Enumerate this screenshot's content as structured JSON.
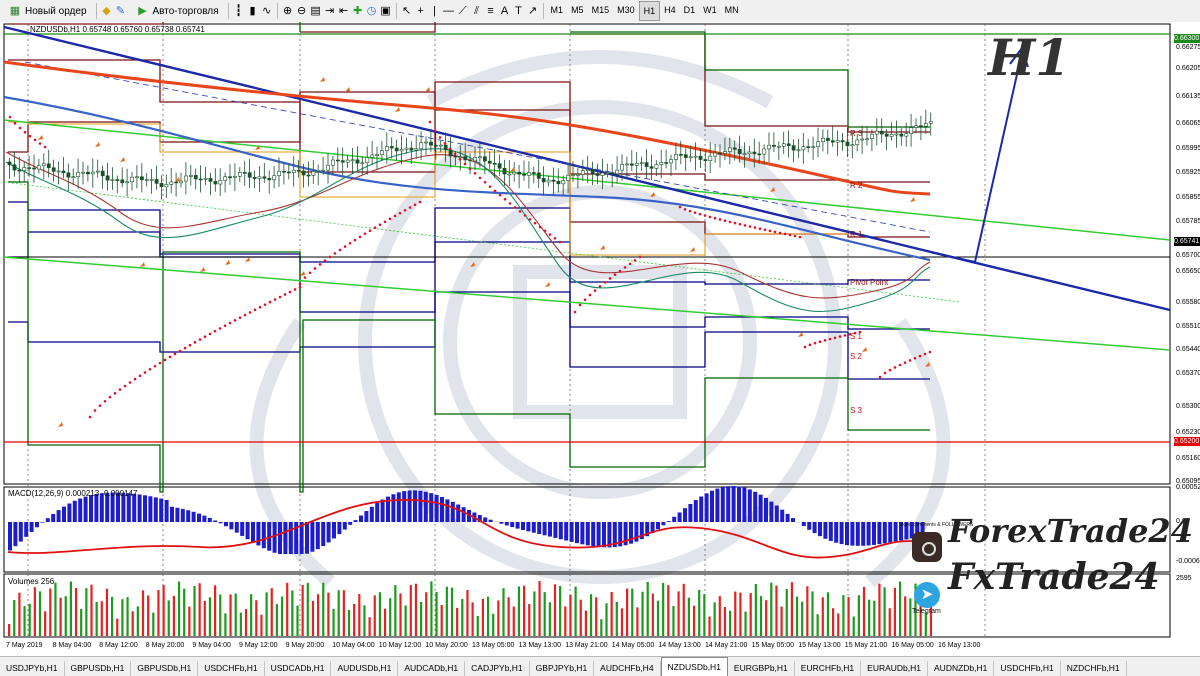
{
  "toolbar": {
    "new_order": "Новый ордер",
    "autotrading": "Авто-торговля",
    "timeframes": [
      "M1",
      "M5",
      "M15",
      "M30",
      "H1",
      "H4",
      "D1",
      "W1",
      "MN"
    ],
    "active_timeframe": "H1"
  },
  "chart": {
    "title": "NZDUSDb,H1  0.65748 0.65760 0.65738 0.65741",
    "macd_title": "MACD(12,26,9) 0.000213 -0.000147",
    "volume_title": "Volumes 256",
    "price_labels": [
      "0.66300",
      "0.66275",
      "0.66205",
      "0.66135",
      "0.66065",
      "0.65995",
      "0.65925",
      "0.65855",
      "0.65785",
      "0.65741",
      "0.65700",
      "0.65650",
      "0.65580",
      "0.65510",
      "0.65440",
      "0.65370",
      "0.65300",
      "0.65230",
      "0.65200",
      "0.65160",
      "0.65095"
    ],
    "macd_labels": [
      "0.000524",
      "0.00",
      "-0.000624"
    ],
    "volume_label": "2595",
    "time_labels": [
      "7 May 2019",
      "8 May 04:00",
      "8 May 12:00",
      "8 May 20:00",
      "9 May 04:00",
      "9 May 12:00",
      "9 May 20:00",
      "10 May 04:00",
      "10 May 12:00",
      "10 May 20:00",
      "13 May 05:00",
      "13 May 13:00",
      "13 May 21:00",
      "14 May 05:00",
      "14 May 13:00",
      "14 May 21:00",
      "15 May 05:00",
      "15 May 13:00",
      "15 May 21:00",
      "16 May 05:00",
      "16 May 13:00"
    ],
    "pivot_labels": [
      "R 3",
      "R 2",
      "R 1",
      "Pivot Point",
      "S 1",
      "S 2",
      "S 3"
    ],
    "timeframe_watermark": "H1",
    "current_price_tag": "0.65741",
    "red_level_tag": "0.65200",
    "green_level_tag": "0.66300"
  },
  "branding": {
    "brand1": "ForexTrade24",
    "brand2": "FxTrade24",
    "followers_caption": "likes, comments & FOLLOWERS",
    "telegram_caption": "Telegram"
  },
  "tabs": [
    "USDJPYb,H1",
    "GBPUSDb,H1",
    "GBPUSDb,H1",
    "USDCHFb,H1",
    "USDCADb,H1",
    "AUDUSDb,H1",
    "AUDCADb,H1",
    "CADJPYb,H1",
    "GBPJPYb,H1",
    "AUDCHFb,H4",
    "NZDUSDb,H1",
    "EURGBPb,H1",
    "EURCHFb,H1",
    "EURAUDb,H1",
    "AUDNZDb,H1",
    "USDCHFb,H1",
    "NZDCHFb,H1"
  ],
  "active_tab_index": 10,
  "colors": {
    "candle": "#1a4f2c",
    "pivot_upper": "#7a1010",
    "pivot_lower": "#000080",
    "pivot_green": "#006400",
    "trend_blue": "#1a2aa8",
    "ma_red": "#e8451a",
    "ma_blue": "#3a63c8",
    "channel_green": "#33cc33",
    "sar": "#e0102a",
    "macd_hist": "#1d1dcc",
    "volume_up": "#1c9a1c",
    "volume_down": "#e52222"
  }
}
